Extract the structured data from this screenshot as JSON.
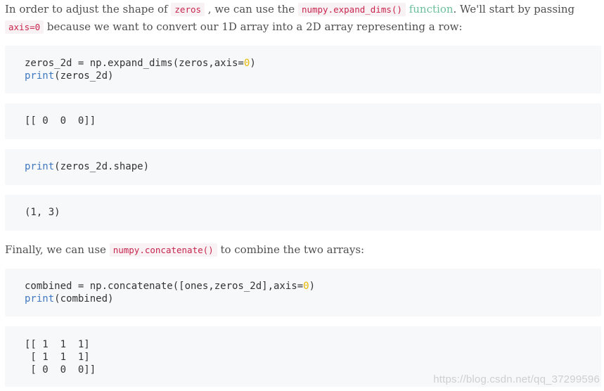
{
  "intro": {
    "text_1": "In order to adjust the shape of ",
    "code_zeros": "zeros",
    "text_2": " , we can use the ",
    "code_expand": "numpy.expand_dims()",
    "text_3": " ",
    "link_function": "function",
    "text_4": ". We'll start by passing",
    "code_axis": "axis=0",
    "text_5": " because we want to convert our 1D array into a 2D array representing a row:"
  },
  "code1": {
    "line1_a": "zeros_2d = np.expand_dims(zeros,axis=",
    "line1_num": "0",
    "line1_b": ")",
    "line2_kw": "print",
    "line2_rest": "(zeros_2d)"
  },
  "out1": {
    "line1": "[[ 0  0  0]]"
  },
  "code2": {
    "kw": "print",
    "rest": "(zeros_2d.shape)"
  },
  "out2": {
    "line1": "(1, 3)"
  },
  "finally": {
    "text_1": "Finally, we can use ",
    "code_concat": "numpy.concatenate()",
    "text_2": " to combine the two arrays:"
  },
  "code3": {
    "line1_a": "combined = np.concatenate([ones,zeros_2d],axis=",
    "line1_num": "0",
    "line1_b": ")",
    "line2_kw": "print",
    "line2_rest": "(combined)"
  },
  "out3": {
    "line1": "[[ 1  1  1]",
    "line2": " [ 0  0  0]]",
    "line1b": " [ 1  1  1]"
  },
  "watermark": "https://blog.csdn.net/qq_37299596",
  "colors": {
    "inline_code_text": "#c7254e",
    "inline_code_bg": "#f9f2f4",
    "code_block_bg": "#f6f8fa",
    "keyword": "#4078c0",
    "number": "#e6b800",
    "link": "#6bbf9c"
  }
}
